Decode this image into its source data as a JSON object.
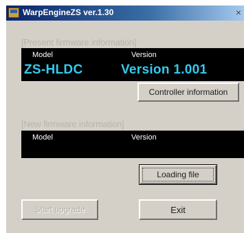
{
  "window": {
    "title": "WarpEngineZS ver.1.30",
    "close_glyph": "×"
  },
  "present": {
    "section_label": "[Present firmware information]",
    "model_header": "Model",
    "version_header": "Version",
    "model_value": "ZS-HLDC",
    "version_value": "Version 1.001"
  },
  "new": {
    "section_label": "[New firmware information]",
    "model_header": "Model",
    "version_header": "Version"
  },
  "buttons": {
    "controller_info": "Controller information",
    "loading_file": "Loading file",
    "start_upgrade": "Start upgrade",
    "exit": "Exit"
  },
  "icons": {
    "app": "app-icon",
    "close": "close-icon"
  },
  "colors": {
    "title_bar_start": "#0a246a",
    "title_bar_end": "#a6caf0",
    "panel_bg": "#000000",
    "value_text": "#33ccee",
    "window_bg": "#d4d0c8"
  }
}
